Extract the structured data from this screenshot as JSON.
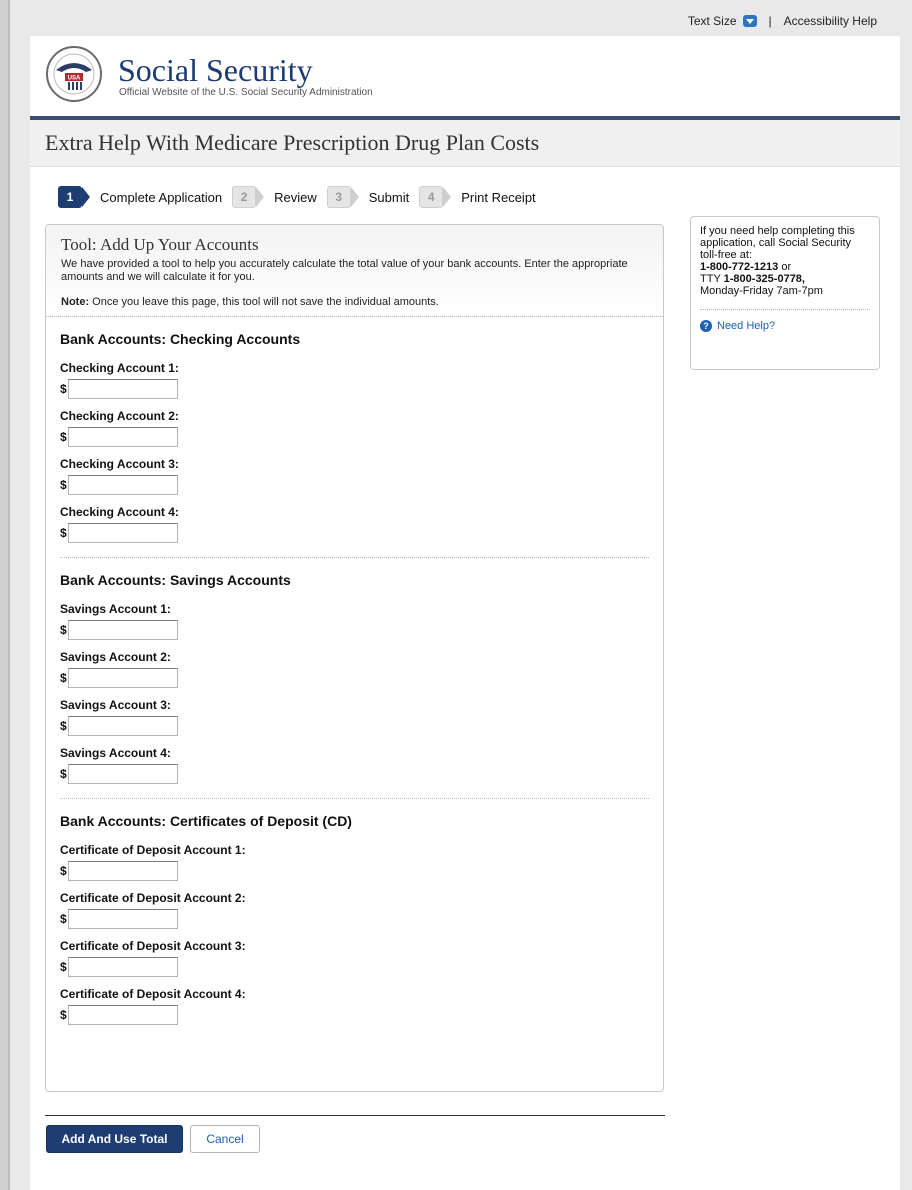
{
  "utility": {
    "text_size_label": "Text Size",
    "separator": "|",
    "accessibility_help": "Accessibility Help"
  },
  "header": {
    "brand_name": "Social Security",
    "brand_subtitle": "Official Website of the U.S. Social Security Administration",
    "seal_text": "USA"
  },
  "page": {
    "title": "Extra Help With Medicare Prescription Drug Plan Costs"
  },
  "steps": [
    {
      "num": "1",
      "label": "Complete Application",
      "active": true
    },
    {
      "num": "2",
      "label": "Review",
      "active": false
    },
    {
      "num": "3",
      "label": "Submit",
      "active": false
    },
    {
      "num": "4",
      "label": "Print Receipt",
      "active": false
    }
  ],
  "tool": {
    "title": "Tool: Add Up Your Accounts",
    "description": "We have provided a tool to help you accurately calculate the total value of your bank accounts. Enter the appropriate amounts and we will calculate it for you.",
    "note_label": "Note:",
    "note_text": " Once you leave this page, this tool will not save the individual amounts.",
    "currency": "$",
    "sections": [
      {
        "heading": "Bank Accounts: Checking Accounts",
        "fields": [
          "Checking Account 1:",
          "Checking Account 2:",
          "Checking Account 3:",
          "Checking Account 4:"
        ]
      },
      {
        "heading": "Bank Accounts: Savings Accounts",
        "fields": [
          "Savings Account 1:",
          "Savings Account 2:",
          "Savings Account 3:",
          "Savings Account 4:"
        ]
      },
      {
        "heading": "Bank Accounts: Certificates of Deposit (CD)",
        "fields": [
          "Certificate of Deposit Account 1:",
          "Certificate of Deposit Account 2:",
          "Certificate of Deposit Account 3:",
          "Certificate of Deposit Account 4:"
        ]
      }
    ]
  },
  "help": {
    "line1": "If you need help completing this application, call Social Security toll-free at:",
    "phone": "1-800-772-1213",
    "or": " or",
    "tty_prefix": "TTY ",
    "tty": "1-800-325-0778,",
    "hours": "Monday-Friday 7am-7pm",
    "need_help": "Need Help?"
  },
  "actions": {
    "primary": "Add And Use Total",
    "cancel": "Cancel"
  },
  "colors": {
    "brand_navy": "#1d3d73",
    "link_blue": "#1b5fb8"
  }
}
